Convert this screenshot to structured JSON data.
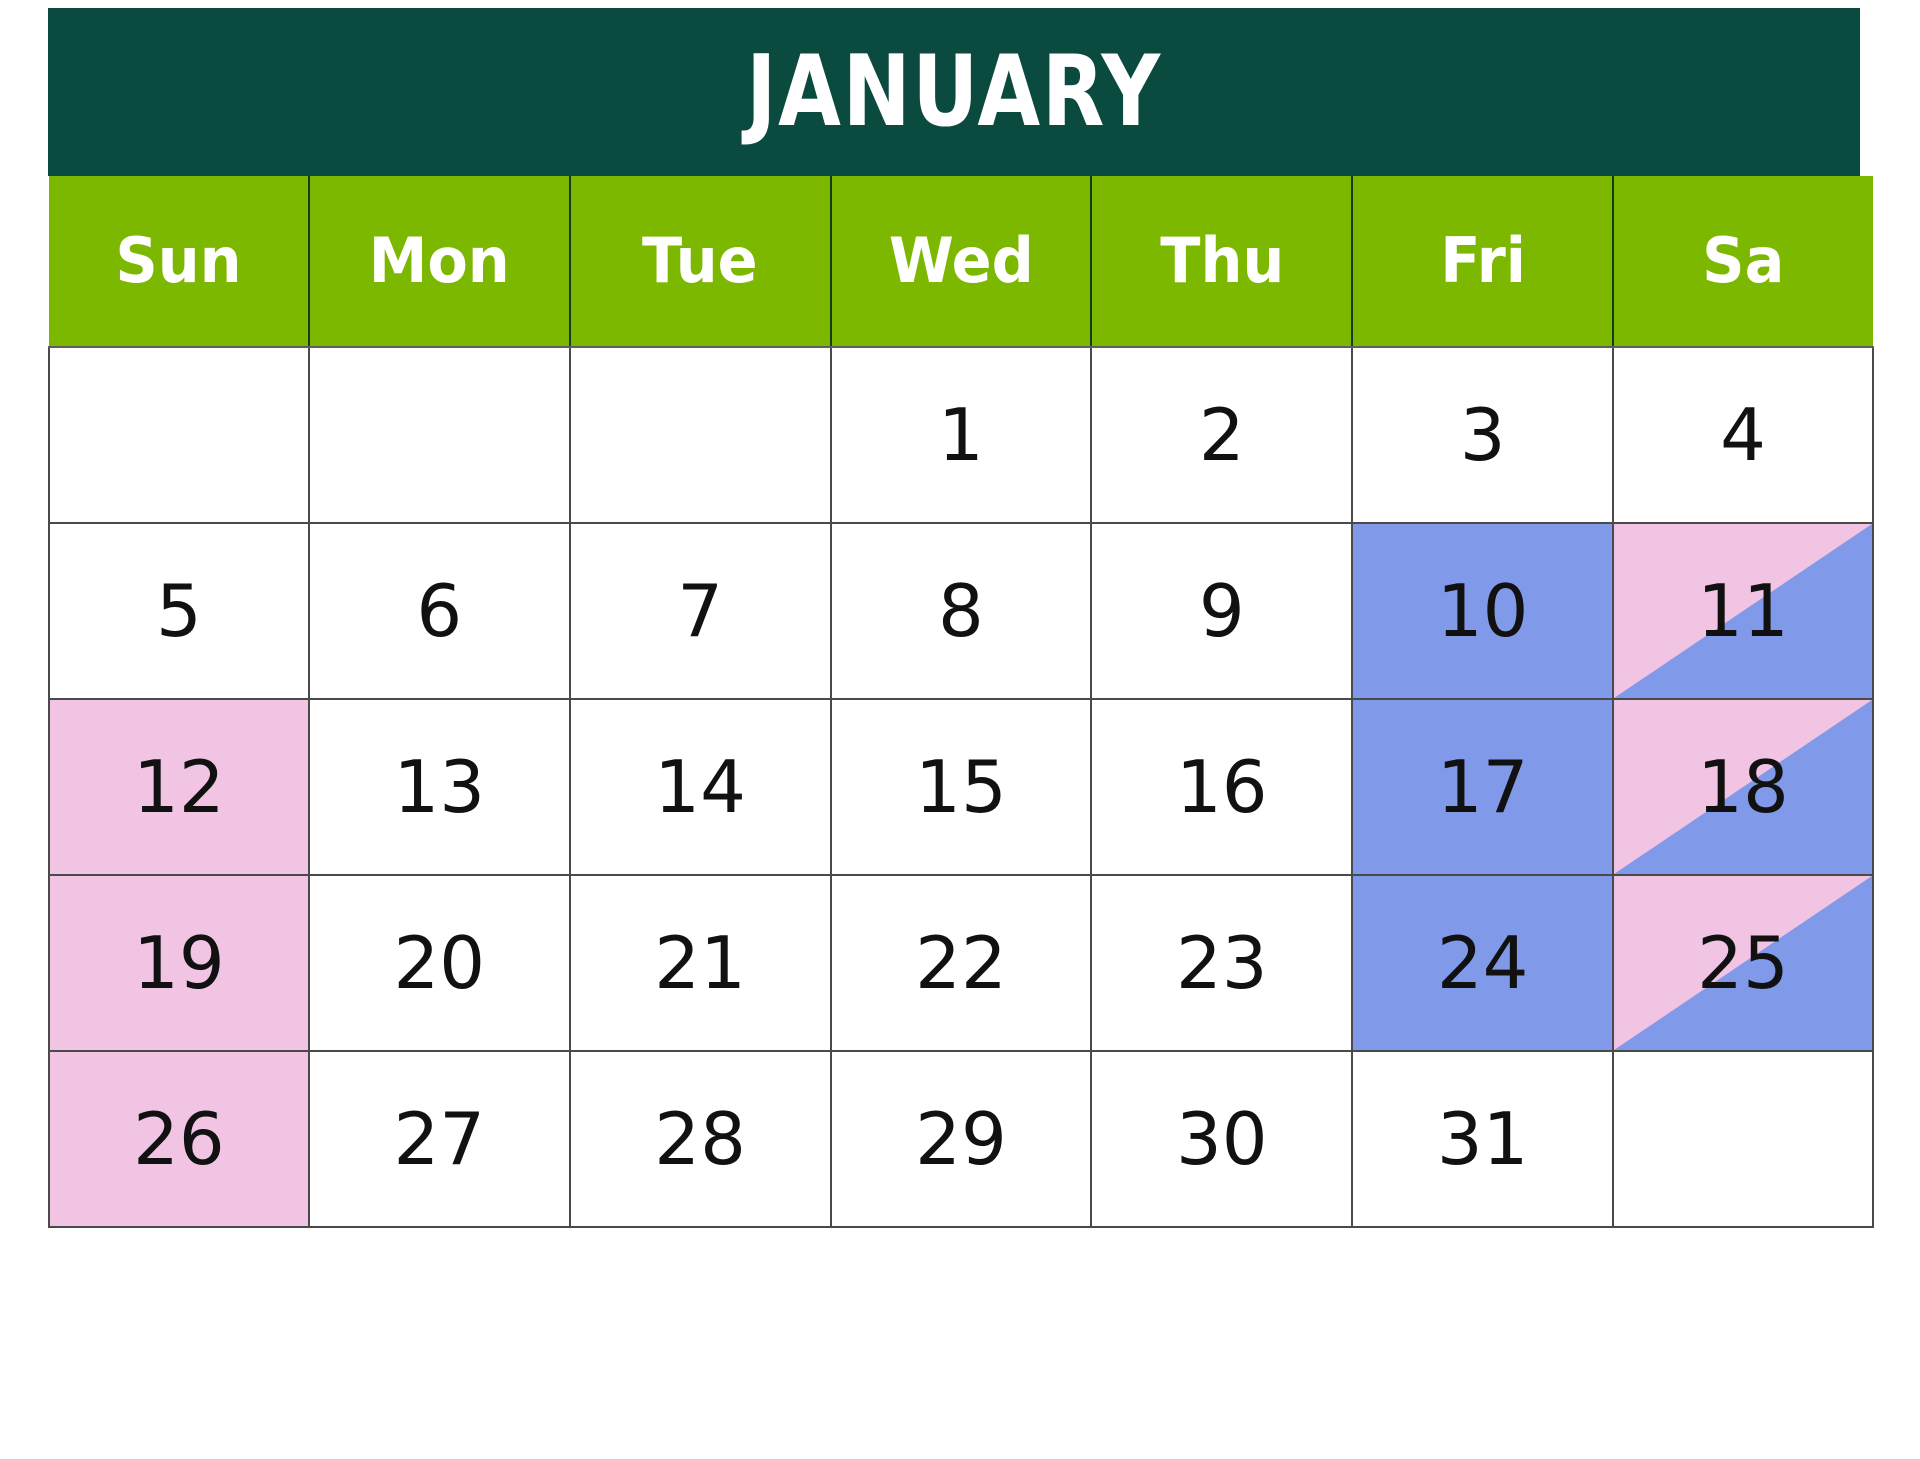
{
  "calendar": {
    "month_title": "JANUARY",
    "colors": {
      "title_bar": "#0b4a3f",
      "weekday_bar": "#7db800",
      "weekday_text": "#ffffff",
      "pink_highlight": "#f2c4e4",
      "blue_highlight": "#8099e8",
      "cell_background": "#ffffff",
      "grid_line": "#4a4a4a",
      "day_text": "#111111"
    },
    "weekdays": [
      {
        "label": "Sun"
      },
      {
        "label": "Mon"
      },
      {
        "label": "Tue"
      },
      {
        "label": "Wed"
      },
      {
        "label": "Thu"
      },
      {
        "label": "Fri"
      },
      {
        "label": "Sa"
      }
    ],
    "weeks": [
      [
        {
          "day": "",
          "fill": "none"
        },
        {
          "day": "",
          "fill": "none"
        },
        {
          "day": "",
          "fill": "none"
        },
        {
          "day": "1",
          "fill": "none"
        },
        {
          "day": "2",
          "fill": "none"
        },
        {
          "day": "3",
          "fill": "none"
        },
        {
          "day": "4",
          "fill": "none"
        }
      ],
      [
        {
          "day": "5",
          "fill": "none"
        },
        {
          "day": "6",
          "fill": "none"
        },
        {
          "day": "7",
          "fill": "none"
        },
        {
          "day": "8",
          "fill": "none"
        },
        {
          "day": "9",
          "fill": "none"
        },
        {
          "day": "10",
          "fill": "blue"
        },
        {
          "day": "11",
          "fill": "split-pink-blue"
        }
      ],
      [
        {
          "day": "12",
          "fill": "pink"
        },
        {
          "day": "13",
          "fill": "none"
        },
        {
          "day": "14",
          "fill": "none"
        },
        {
          "day": "15",
          "fill": "none"
        },
        {
          "day": "16",
          "fill": "none"
        },
        {
          "day": "17",
          "fill": "blue"
        },
        {
          "day": "18",
          "fill": "split-pink-blue"
        }
      ],
      [
        {
          "day": "19",
          "fill": "pink"
        },
        {
          "day": "20",
          "fill": "none"
        },
        {
          "day": "21",
          "fill": "none"
        },
        {
          "day": "22",
          "fill": "none"
        },
        {
          "day": "23",
          "fill": "none"
        },
        {
          "day": "24",
          "fill": "blue"
        },
        {
          "day": "25",
          "fill": "split-pink-blue"
        }
      ],
      [
        {
          "day": "26",
          "fill": "pink"
        },
        {
          "day": "27",
          "fill": "none"
        },
        {
          "day": "28",
          "fill": "none"
        },
        {
          "day": "29",
          "fill": "none"
        },
        {
          "day": "30",
          "fill": "none"
        },
        {
          "day": "31",
          "fill": "none"
        },
        {
          "day": "",
          "fill": "none"
        }
      ]
    ]
  }
}
